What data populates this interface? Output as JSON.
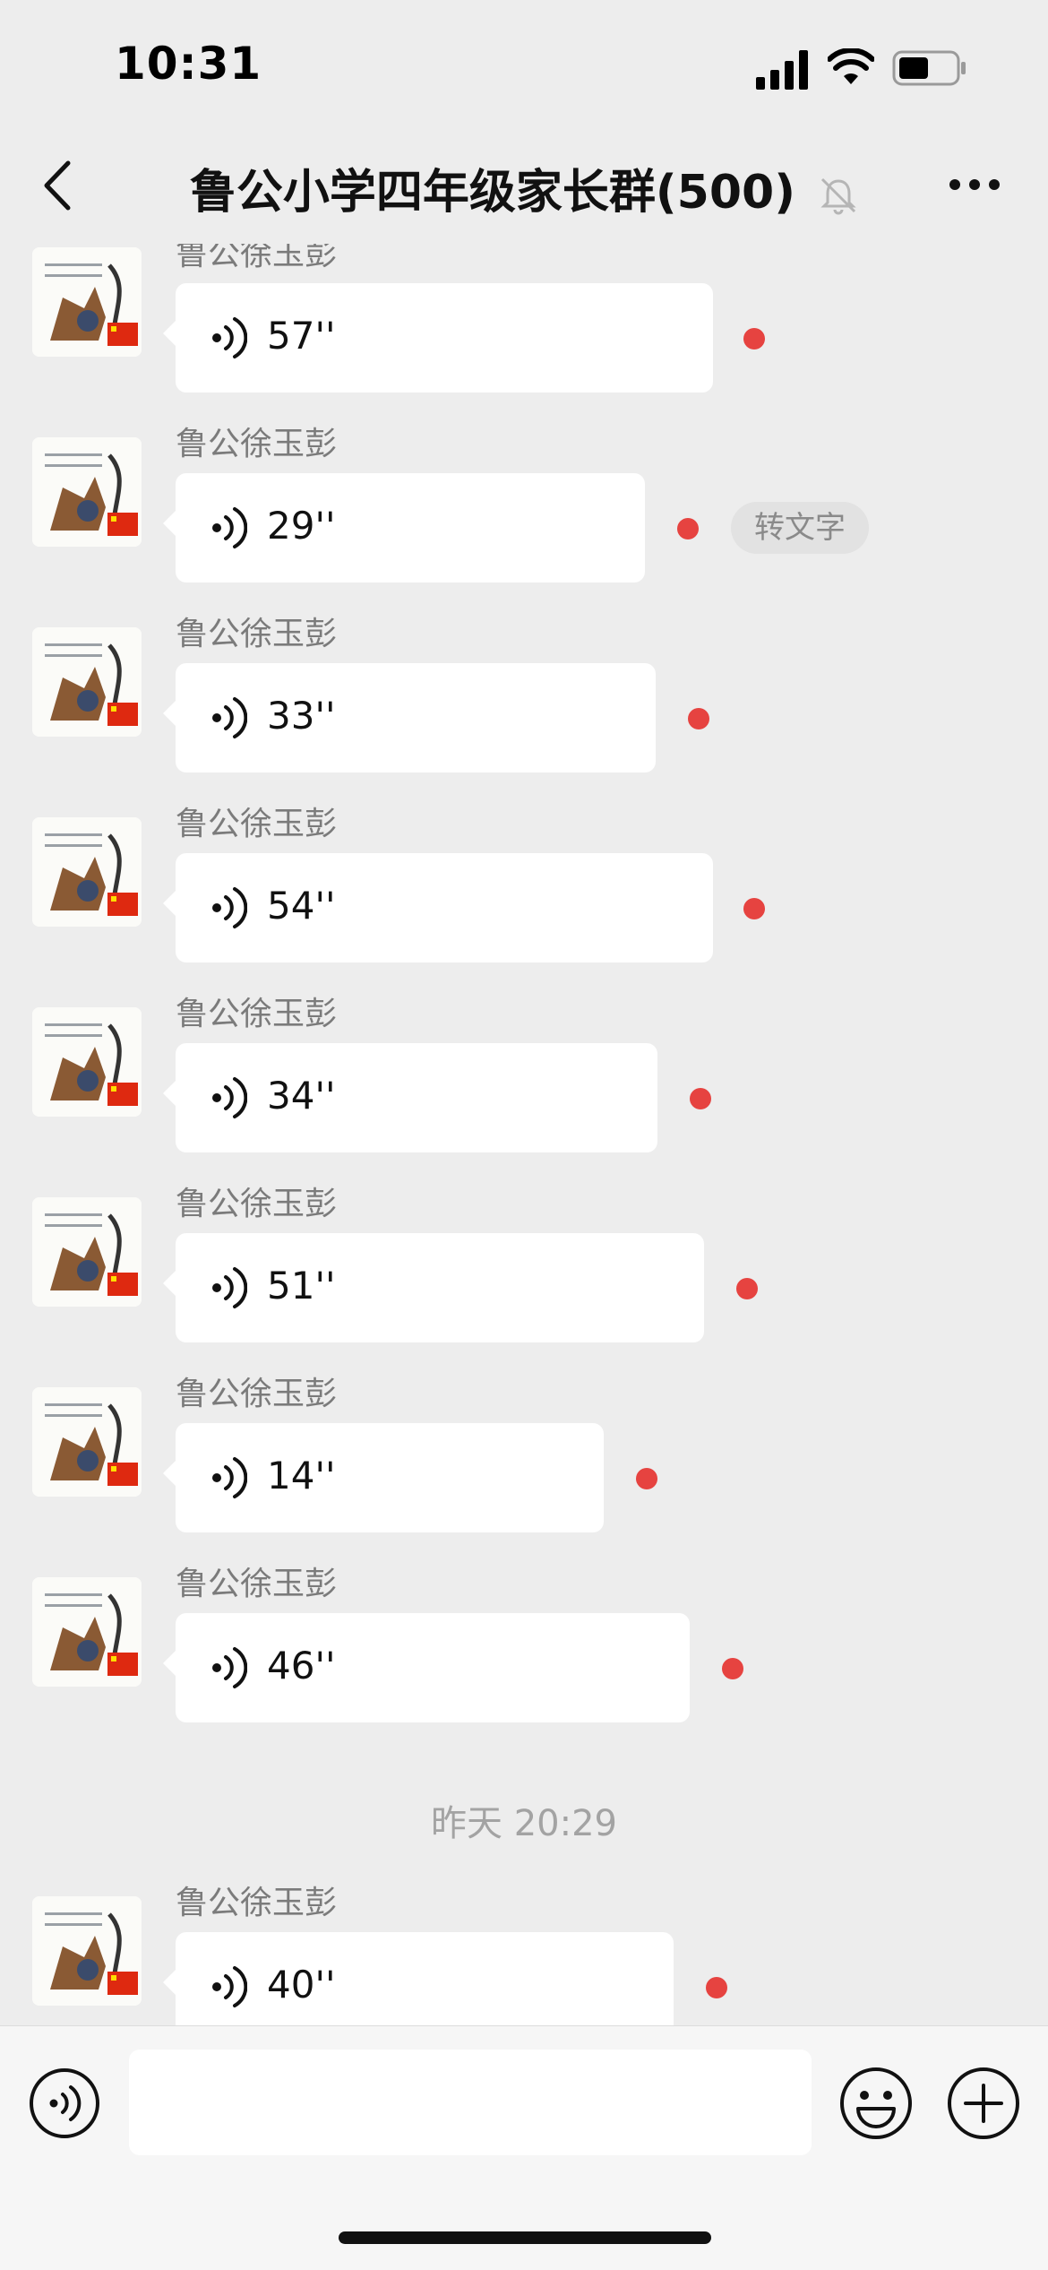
{
  "status_bar": {
    "time": "10:31"
  },
  "nav": {
    "title": "鲁公小学四年级家长群(500)",
    "icons": [
      "back-icon",
      "mute-bell-icon",
      "more-icon"
    ]
  },
  "messages": [
    {
      "sender": "鲁公徐玉彭",
      "duration": "57''",
      "unread": true
    },
    {
      "sender": "鲁公徐玉彭",
      "duration": "29''",
      "unread": true,
      "action": "转文字"
    },
    {
      "sender": "鲁公徐玉彭",
      "duration": "33''",
      "unread": true
    },
    {
      "sender": "鲁公徐玉彭",
      "duration": "54''",
      "unread": true
    },
    {
      "sender": "鲁公徐玉彭",
      "duration": "34''",
      "unread": true
    },
    {
      "sender": "鲁公徐玉彭",
      "duration": "51''",
      "unread": true
    },
    {
      "sender": "鲁公徐玉彭",
      "duration": "14''",
      "unread": true
    },
    {
      "sender": "鲁公徐玉彭",
      "duration": "46''",
      "unread": true
    },
    {
      "sender": "鲁公徐玉彭",
      "duration": "40''",
      "unread": true
    }
  ],
  "timestamp": "昨天 20:29",
  "input_bar": {
    "value": "",
    "icons": [
      "voice-mode-icon",
      "emoji-icon",
      "plus-icon"
    ]
  },
  "colors": {
    "background": "#ededed",
    "bubble": "#ffffff",
    "unread_dot": "#e64340",
    "sender_text": "#7b7b7b"
  }
}
